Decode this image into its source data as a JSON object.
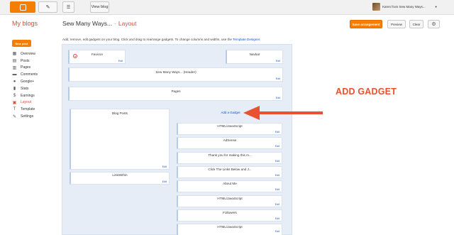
{
  "topbar": {
    "view_blog": "View blog",
    "user": "Karen from Sew Many Ways..."
  },
  "header": {
    "my_blogs": "My blogs",
    "blog_title": "Sew Many Ways...",
    "separator": "·",
    "page": "Layout",
    "save_arrangement": "Save arrangement",
    "preview": "Preview",
    "clear": "Clear"
  },
  "sidebar": {
    "new_post": "New post",
    "items": [
      {
        "label": "Overview",
        "icon": "overview-icon"
      },
      {
        "label": "Posts",
        "icon": "posts-icon"
      },
      {
        "label": "Pages",
        "icon": "pages-icon"
      },
      {
        "label": "Comments",
        "icon": "comments-icon"
      },
      {
        "label": "Google+",
        "icon": "google-plus-icon"
      },
      {
        "label": "Stats",
        "icon": "stats-icon"
      },
      {
        "label": "Earnings",
        "icon": "earnings-icon"
      },
      {
        "label": "Layout",
        "icon": "layout-icon"
      },
      {
        "label": "Template",
        "icon": "template-icon"
      },
      {
        "label": "Settings",
        "icon": "settings-icon"
      }
    ]
  },
  "description": {
    "text": "Add, remove, edit gadgets on your blog. Click and drag to rearrange gadgets. To change columns and widths, use the",
    "link": "Template Designer",
    "end": "."
  },
  "gadgets": {
    "edit": "Edit",
    "favicon": "Favicon",
    "navbar": "Navbar",
    "header": "Sew Many Ways... (Header)",
    "pages": "Pages",
    "blog_posts": "Blog Posts",
    "linkwithin": "LinkWithin",
    "add_gadget": "Add a Gadget",
    "sidebar_list": [
      "HTML/JavaScript",
      "AdSense",
      "Thank you for making this m...",
      "Click The Links Below and J...",
      "About Me",
      "HTML/JavaScript",
      "Followers",
      "HTML/JavaScript"
    ]
  },
  "annotation": {
    "label": "ADD GADGET",
    "color": "#e8522e"
  },
  "colors": {
    "accent": "#f57d00",
    "link": "#1155cc",
    "title_red": "#dd4b39"
  }
}
